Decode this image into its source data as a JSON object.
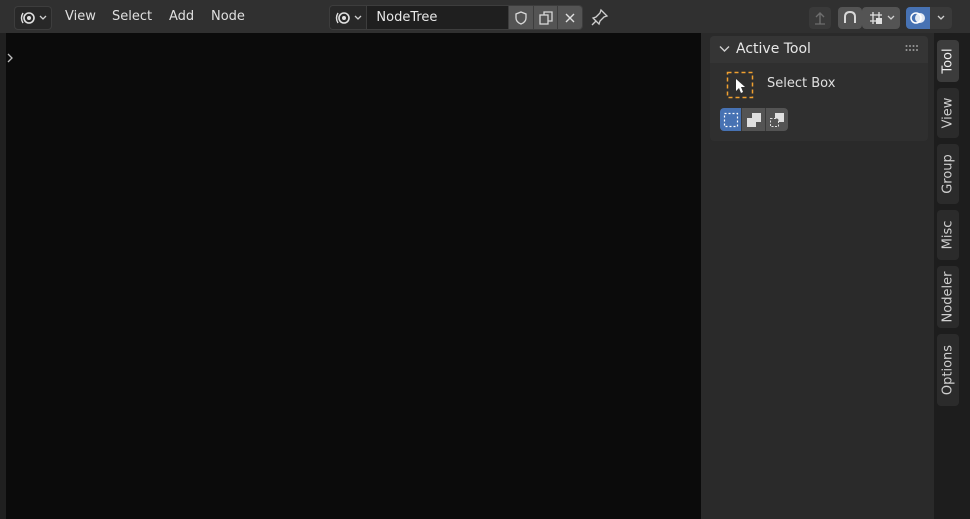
{
  "header": {
    "menus": [
      "View",
      "Select",
      "Add",
      "Node"
    ],
    "node_tree": {
      "name": "NodeTree"
    }
  },
  "colors": {
    "accent": "#4772b3",
    "selection": "#f0a030"
  },
  "icons": {
    "editor_type": "shader-editor-icon",
    "fake_user": "shield-icon",
    "duplicate": "duplicate-icon",
    "unlink": "close-icon",
    "pin": "pin-icon",
    "parent": "parent-node-tree-icon",
    "snap": "snap-icon",
    "snap_mode": "snap-increment-icon",
    "overlays": "overlays-icon"
  },
  "sidebar": {
    "panel": {
      "title": "Active Tool",
      "tool_name": "Select Box"
    },
    "tabs": [
      "Tool",
      "View",
      "Group",
      "Misc",
      "Nodeler",
      "Options"
    ]
  }
}
